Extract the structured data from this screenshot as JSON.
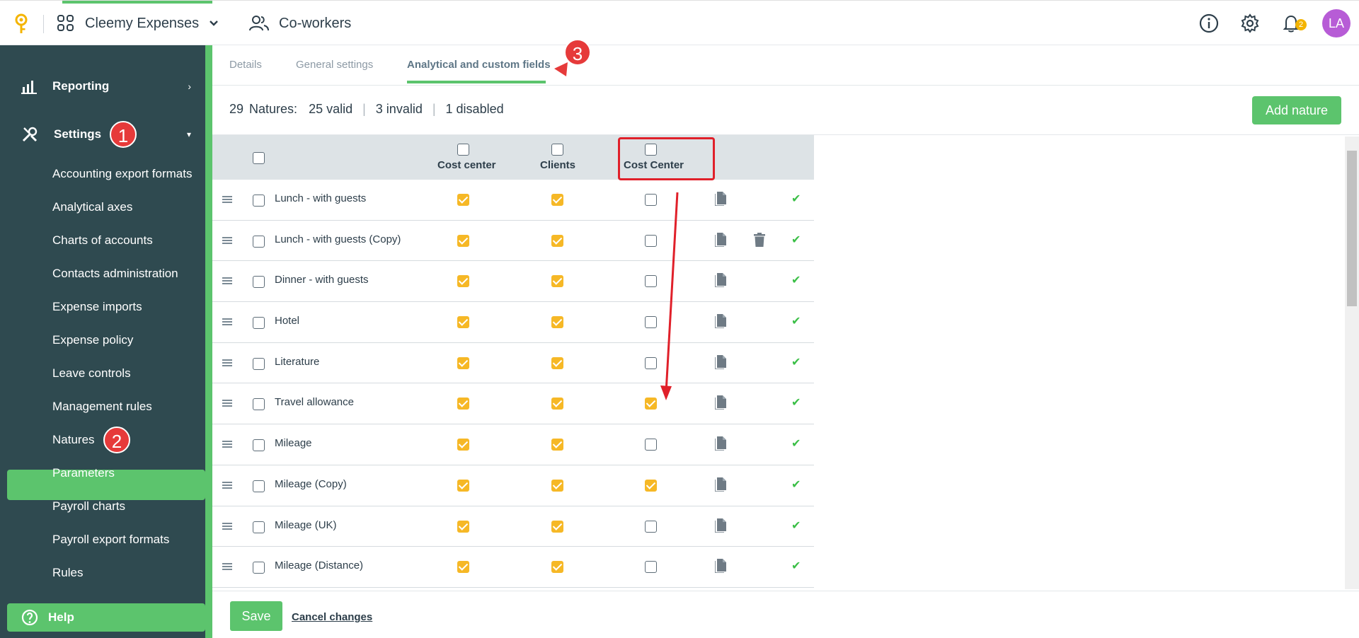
{
  "topbar": {
    "app_title": "Cleemy Expenses",
    "coworkers_label": "Co-workers",
    "notification_count": "2",
    "avatar_initials": "LA"
  },
  "sidebar": {
    "reporting_label": "Reporting",
    "settings_label": "Settings",
    "items": [
      "Accounting export formats",
      "Analytical axes",
      "Charts of accounts",
      "Contacts administration",
      "Expense imports",
      "Expense policy",
      "Leave controls",
      "Management rules",
      "Natures",
      "Parameters",
      "Payroll charts",
      "Payroll export formats",
      "Rules"
    ],
    "help_label": "Help"
  },
  "callouts": [
    "1",
    "2",
    "3"
  ],
  "tabs": [
    "Details",
    "General settings",
    "Analytical and custom fields"
  ],
  "summary": {
    "count": "29",
    "label": "Natures:",
    "valid": "25 valid",
    "invalid": "3 invalid",
    "disabled": "1 disabled"
  },
  "add_button": "Add nature",
  "table": {
    "columns": [
      "Cost center",
      "Clients",
      "Cost Center"
    ],
    "rows": [
      {
        "name": "Lunch - with guests",
        "cost_center": true,
        "clients": true,
        "cost_center_2": false,
        "deletable": false
      },
      {
        "name": "Lunch - with guests (Copy)",
        "cost_center": true,
        "clients": true,
        "cost_center_2": false,
        "deletable": true
      },
      {
        "name": "Dinner - with guests",
        "cost_center": true,
        "clients": true,
        "cost_center_2": false,
        "deletable": false
      },
      {
        "name": "Hotel",
        "cost_center": true,
        "clients": true,
        "cost_center_2": false,
        "deletable": false
      },
      {
        "name": "Literature",
        "cost_center": true,
        "clients": true,
        "cost_center_2": false,
        "deletable": false
      },
      {
        "name": "Travel allowance",
        "cost_center": true,
        "clients": true,
        "cost_center_2": true,
        "deletable": false
      },
      {
        "name": "Mileage",
        "cost_center": true,
        "clients": true,
        "cost_center_2": false,
        "deletable": false
      },
      {
        "name": "Mileage (Copy)",
        "cost_center": true,
        "clients": true,
        "cost_center_2": true,
        "deletable": false
      },
      {
        "name": "Mileage (UK)",
        "cost_center": true,
        "clients": true,
        "cost_center_2": false,
        "deletable": false
      },
      {
        "name": "Mileage (Distance)",
        "cost_center": true,
        "clients": true,
        "cost_center_2": false,
        "deletable": false
      }
    ]
  },
  "footer": {
    "save_label": "Save",
    "cancel_label": "Cancel changes"
  },
  "colors": {
    "accent_green": "#5cc46d",
    "sidebar_bg": "#2f4a50",
    "checkbox_checked": "#f6b826",
    "annotation_red": "#e0202a"
  }
}
